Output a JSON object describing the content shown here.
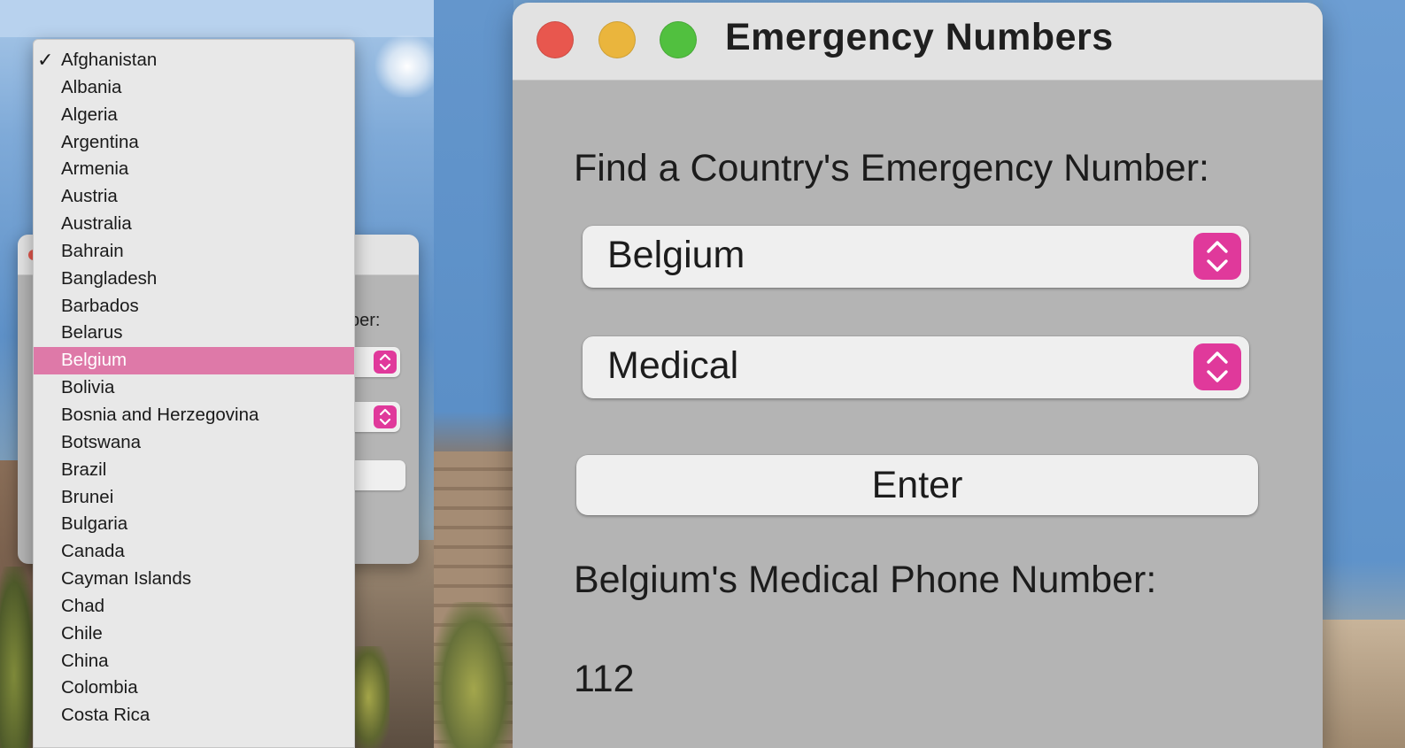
{
  "window": {
    "title": "Emergency Numbers"
  },
  "form": {
    "prompt": "Find a Country's Emergency Number:",
    "country_selected": "Belgium",
    "service_selected": "Medical",
    "enter_label": "Enter"
  },
  "result": {
    "label": "Belgium's Medical Phone Number:",
    "number": "112"
  },
  "background_window": {
    "partial_label": "ber:"
  },
  "dropdown": {
    "checkmark": "✓",
    "checked_item": "Afghanistan",
    "highlighted_item": "Belgium",
    "items": [
      "Afghanistan",
      "Albania",
      "Algeria",
      "Argentina",
      "Armenia",
      "Austria",
      "Australia",
      "Bahrain",
      "Bangladesh",
      "Barbados",
      "Belarus",
      "Belgium",
      "Bolivia",
      "Bosnia and Herzegovina",
      "Botswana",
      "Brazil",
      "Brunei",
      "Bulgaria",
      "Canada",
      "Cayman Islands",
      "Chad",
      "Chile",
      "China",
      "Colombia",
      "Costa Rica"
    ]
  },
  "colors": {
    "accent_pink": "#e0399b",
    "highlight_row": "#de79a8",
    "close_button": "#e8574e",
    "minimize_button": "#eab53d",
    "zoom_button": "#51c03f"
  },
  "icons": {
    "stepper": "chevron-up-down-icon",
    "check": "checkmark-icon"
  }
}
